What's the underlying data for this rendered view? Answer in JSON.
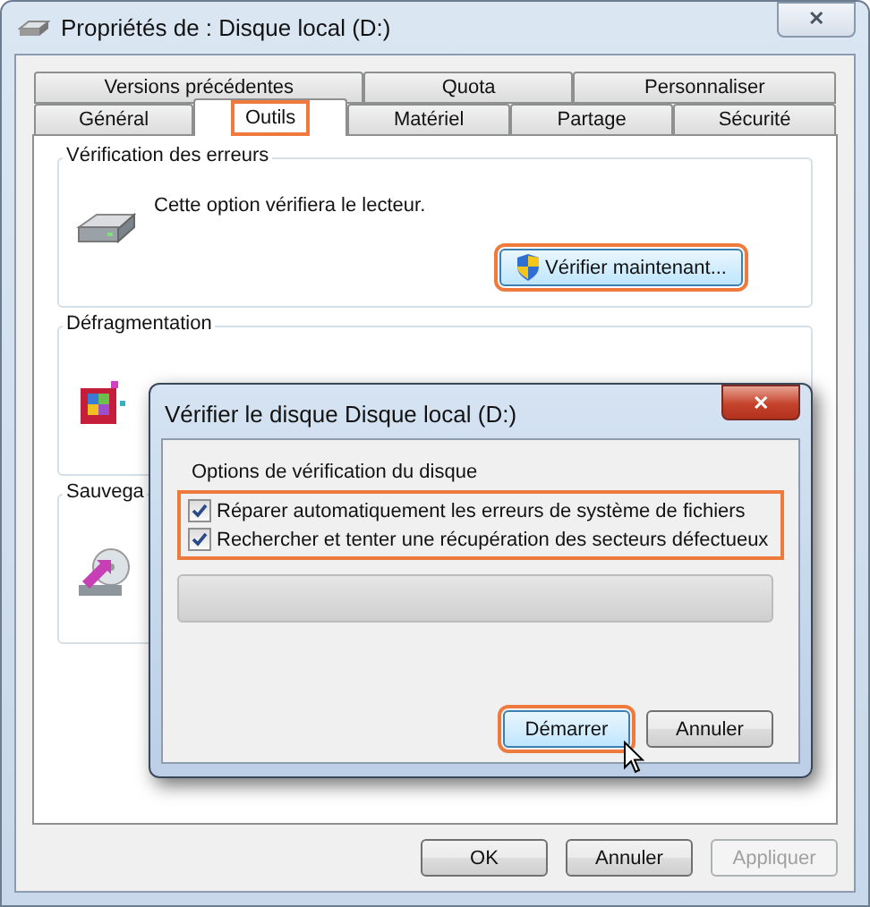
{
  "window": {
    "title": "Propriétés de : Disque local (D:)",
    "close": "✕"
  },
  "tab_rows": [
    [
      {
        "label": "Versions précédentes",
        "selected": false,
        "highlighted": false
      },
      {
        "label": "Quota",
        "selected": false,
        "highlighted": false
      },
      {
        "label": "Personnaliser",
        "selected": false,
        "highlighted": false
      }
    ],
    [
      {
        "label": "Général",
        "selected": false,
        "highlighted": false
      },
      {
        "label": "Outils",
        "selected": true,
        "highlighted": true
      },
      {
        "label": "Matériel",
        "selected": false,
        "highlighted": false
      },
      {
        "label": "Partage",
        "selected": false,
        "highlighted": false
      },
      {
        "label": "Sécurité",
        "selected": false,
        "highlighted": false
      }
    ]
  ],
  "groups": [
    {
      "title": "Vérification des erreurs",
      "kind": "drive",
      "text": "Cette option vérifiera le lecteur.",
      "button": {
        "label": "Vérifier maintenant...",
        "highlighted": true
      }
    },
    {
      "title": "Défragmentation",
      "kind": "defrag"
    },
    {
      "title": "Sauvega",
      "kind": "backup"
    }
  ],
  "dialog": {
    "title": "Vérifier le disque Disque local (D:)",
    "close": "✕",
    "group_title": "Options de vérification du disque",
    "options_highlighted": true,
    "options": [
      {
        "label": "Réparer automatiquement les erreurs de système de fichiers",
        "checked": true
      },
      {
        "label": "Rechercher et tenter une récupération des secteurs défectueux",
        "checked": true
      }
    ],
    "progress": {
      "level": 0
    },
    "buttons": [
      {
        "label": "Démarrer",
        "highlighted": true
      },
      {
        "label": "Annuler",
        "highlighted": false
      }
    ]
  },
  "buttons": [
    {
      "label": "OK",
      "disabled": false
    },
    {
      "label": "Annuler",
      "disabled": false
    },
    {
      "label": "Appliquer",
      "disabled": true
    }
  ]
}
